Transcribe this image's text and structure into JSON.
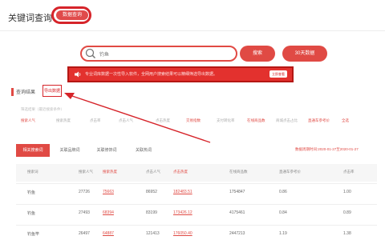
{
  "header": {
    "title": "关键词查询",
    "badge": "数据查询"
  },
  "search": {
    "value": "钓鱼",
    "button": "搜索",
    "thirty_day_button": "30天数据"
  },
  "notice": {
    "text": "专业词库数据一次性导入软件，全网用户搜索结果可以精细筛选导出数据。",
    "button": "立即查看"
  },
  "results": {
    "label": "查询结果",
    "export_button": "导出数据",
    "filter_hint": "筛选结果（最近搜索条件）"
  },
  "filters": [
    {
      "label": "搜索人气",
      "color": "red"
    },
    {
      "label": "搜索热度",
      "color": "grey"
    },
    {
      "label": "点击率",
      "color": "grey"
    },
    {
      "label": "点击人气",
      "color": "grey"
    },
    {
      "label": "点击热度",
      "color": "grey"
    },
    {
      "label": "交易指数",
      "color": "red"
    },
    {
      "label": "支付转化率",
      "color": "grey"
    },
    {
      "label": "在线商品数",
      "color": "red"
    },
    {
      "label": "商城点击占比",
      "color": "grey"
    },
    {
      "label": "直通车参考价",
      "color": "red"
    },
    {
      "label": "全选",
      "color": "red"
    }
  ],
  "tabs": [
    {
      "label": "相关搜索词",
      "active": true
    },
    {
      "label": "关联品牌词",
      "active": false
    },
    {
      "label": "关联修饰词",
      "active": false
    },
    {
      "label": "关联热词",
      "active": false
    }
  ],
  "date_range": "数据周期时间:2020-01-27至2020-01-27",
  "table": {
    "headers": [
      {
        "label": "搜索词",
        "color": "grey"
      },
      {
        "label": "搜索人气",
        "color": "grey"
      },
      {
        "label": "搜索热度",
        "color": "red"
      },
      {
        "label": "点击人气",
        "color": "grey"
      },
      {
        "label": "点击热度",
        "color": "red"
      },
      {
        "label": "在线商品数",
        "color": "grey"
      },
      {
        "label": "直通车参考价",
        "color": "grey"
      },
      {
        "label": "点击率",
        "color": "grey"
      }
    ],
    "rows": [
      [
        "钓鱼",
        "27726",
        "75663",
        "86952",
        "182483.51",
        "1754847",
        "0.86",
        "1.00"
      ],
      [
        "钓鱼",
        "27493",
        "68394",
        "83199",
        "173426.12",
        "4175461",
        "0.84",
        "0.89"
      ],
      [
        "钓鱼竿",
        "26497",
        "64887",
        "121413",
        "176050.40",
        "2447213",
        "1.19",
        "1.38"
      ]
    ]
  },
  "colors": {
    "accent": "#e04a44",
    "accent_dark": "#d6242a"
  }
}
